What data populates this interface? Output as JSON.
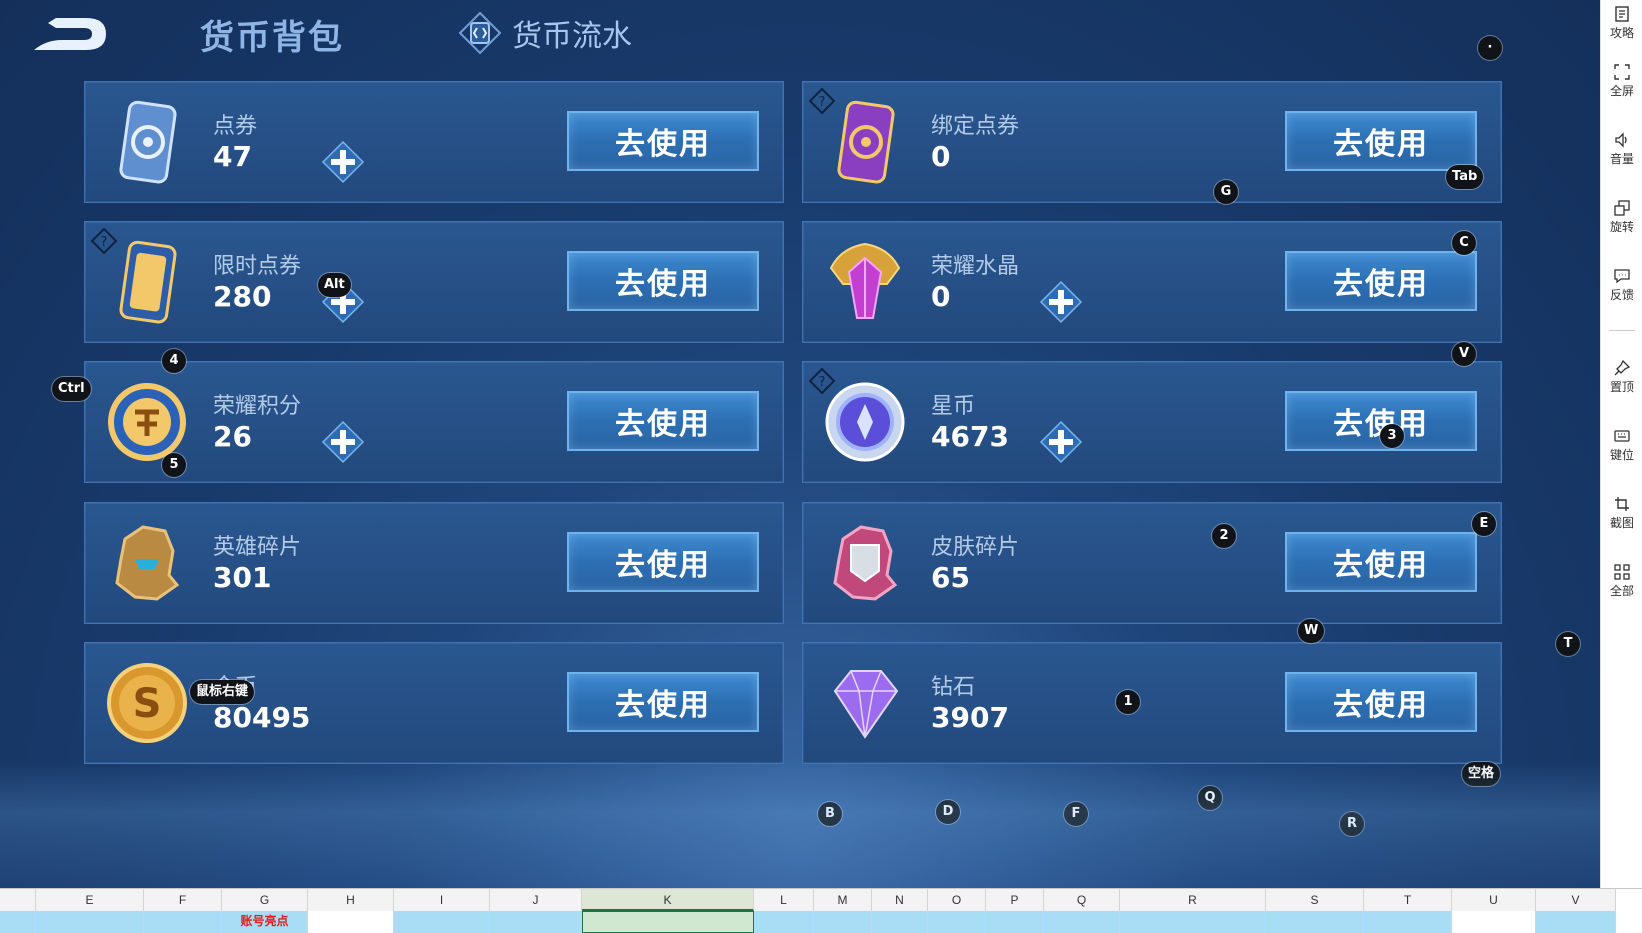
{
  "header": {
    "title": "货币背包",
    "tab_label": "货币流水"
  },
  "cards": [
    {
      "name": "点券",
      "amount": "47",
      "button": "去使用",
      "icon": "coupon-icon"
    },
    {
      "name": "绑定点券",
      "amount": "0",
      "button": "去使用",
      "icon": "bound-coupon-icon"
    },
    {
      "name": "限时点券",
      "amount": "280",
      "button": "去使用",
      "icon": "limited-coupon-icon"
    },
    {
      "name": "荣耀水晶",
      "amount": "0",
      "button": "去使用",
      "icon": "glory-crystal-icon"
    },
    {
      "name": "荣耀积分",
      "amount": "26",
      "button": "去使用",
      "icon": "glory-points-icon"
    },
    {
      "name": "星币",
      "amount": "4673",
      "button": "去使用",
      "icon": "star-coin-icon"
    },
    {
      "name": "英雄碎片",
      "amount": "301",
      "button": "去使用",
      "icon": "hero-fragment-icon"
    },
    {
      "name": "皮肤碎片",
      "amount": "65",
      "button": "去使用",
      "icon": "skin-fragment-icon"
    },
    {
      "name": "金币",
      "amount": "80495",
      "button": "去使用",
      "icon": "gold-coin-icon"
    },
    {
      "name": "钻石",
      "amount": "3907",
      "button": "去使用",
      "icon": "diamond-icon"
    }
  ],
  "key_hints": {
    "dot": "·",
    "g": "G",
    "tab": "Tab",
    "c": "C",
    "alt": "Alt",
    "four": "4",
    "v": "V",
    "ctrl": "Ctrl",
    "five": "5",
    "three": "3",
    "two": "2",
    "e": "E",
    "w": "W",
    "t": "T",
    "right_click": "鼠标右键",
    "one": "1",
    "space": "空格",
    "q": "Q",
    "b": "B",
    "d": "D",
    "f": "F",
    "r": "R"
  },
  "sidebar": {
    "items": [
      "攻略",
      "全屏",
      "音量",
      "旋转",
      "反馈",
      "置顶",
      "键位",
      "截图",
      "全部"
    ]
  },
  "sheet": {
    "columns": [
      "E",
      "F",
      "G",
      "H",
      "I",
      "J",
      "K",
      "L",
      "M",
      "N",
      "O",
      "P",
      "Q",
      "R",
      "S",
      "T",
      "U",
      "V"
    ],
    "cell_text": "账号亮点"
  },
  "colors": {
    "background": "#183a6b",
    "card": "#24497d",
    "button": "#2f74b8",
    "label": "#b4cbe8",
    "value": "#ffffff"
  }
}
